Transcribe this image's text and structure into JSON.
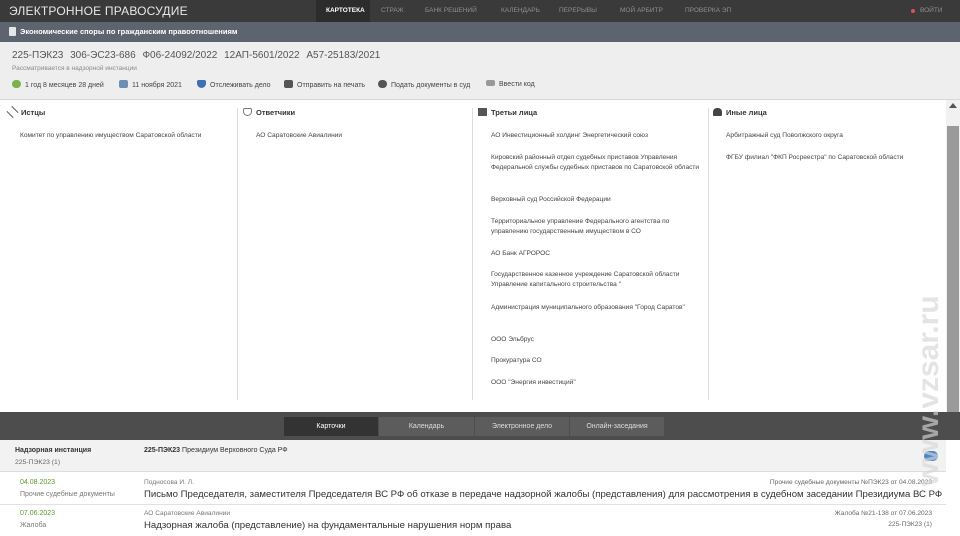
{
  "header": {
    "brand": "ЭЛЕКТРОННОЕ ПРАВОСУДИЕ",
    "nav": [
      "КАРТОТЕКА",
      "СТРАЖ",
      "БАНК РЕШЕНИЙ",
      "КАЛЕНДАРЬ",
      "ПЕРЕРЫВЫ",
      "МОЙ АРБИТР",
      "ПРОВЕРКА ЭП"
    ],
    "logout": "ВОЙТИ"
  },
  "category": "Экономические споры по гражданским правоотношениям",
  "case": {
    "numbers": "225-ПЭК23   306-ЭС23-686   Ф06-24092/2022   12АП-5601/2022   А57-25183/2021",
    "status": "Рассматривается в надзорной инстанции",
    "duration": "1 год 8 месяцев 28 дней",
    "date": "11 ноября 2021",
    "actions": {
      "track": "Отслеживать дело",
      "print": "Отправить на печать",
      "submit": "Подать документы в суд",
      "code": "Ввести код"
    }
  },
  "participants": {
    "plaintiffs": {
      "title": "Истцы",
      "items": [
        "Комитет по управлению имуществом Саратовской области"
      ]
    },
    "defendants": {
      "title": "Ответчики",
      "items": [
        "АО Саратовские Авиалинии"
      ]
    },
    "third": {
      "title": "Третьи лица",
      "items": [
        "АО Инвестиционный холдинг Энергетический союз",
        "Кировский районный отдел судебных приставов Управления Федеральной службы судебных приставов по Саратовской области",
        "Верховный суд Российской Федерации",
        "Территориальное управление Федерального агентства по управлению государственным имуществом в СО",
        "АО Банк АГРОРОС",
        "Государственное казенное учреждение Саратовской области Управление капитального строительства \"",
        "Администрация муниципального образования \"Город Саратов\"",
        "ООО Эльбрус",
        "Прокуратура СО",
        "ООО \"Энергия инвестиций\""
      ]
    },
    "other": {
      "title": "Иные лица",
      "items": [
        "Арбитражный суд Поволжского округа",
        "ФГБУ филиал \"ФКП Росреестра\" по Саратовской области"
      ]
    }
  },
  "tabs": [
    "Карточки",
    "Календарь",
    "Электронное дело",
    "Онлайн-заседания"
  ],
  "instance": {
    "title": "Надзорная инстанция",
    "sub": "225-ПЭК23 (1)",
    "case_no": "225-ПЭК23",
    "court": "Президиум Верховного Суда РФ"
  },
  "documents": [
    {
      "date": "04.08.2023",
      "type": "Прочие судебные документы",
      "author": "Подносова И. Л.",
      "title": "Письмо Председателя, заместителя Председателя ВС РФ об отказе в передаче надзорной жалобы (представления) для рассмотрения в судебном заседании Президиума ВС РФ",
      "right1": "Прочие судебные документы №ПЭК23 от 04.08.2023",
      "right2": ""
    },
    {
      "date": "07.06.2023",
      "type": "Жалоба",
      "author": "АО Саратовские Авиалинии",
      "title": "Надзорная жалоба (представление) на фундаментальные нарушения норм права",
      "right1": "Жалоба №21-138 от 07.06.2023",
      "right2": "225-ПЭК23 (1)"
    }
  ],
  "watermark": "www.vzsar.ru",
  "colors": {
    "topbar": "#3a3a3a",
    "category": "#5d6470",
    "accent_green": "#5a9a2e",
    "tabbar": "#4d4d4d"
  }
}
